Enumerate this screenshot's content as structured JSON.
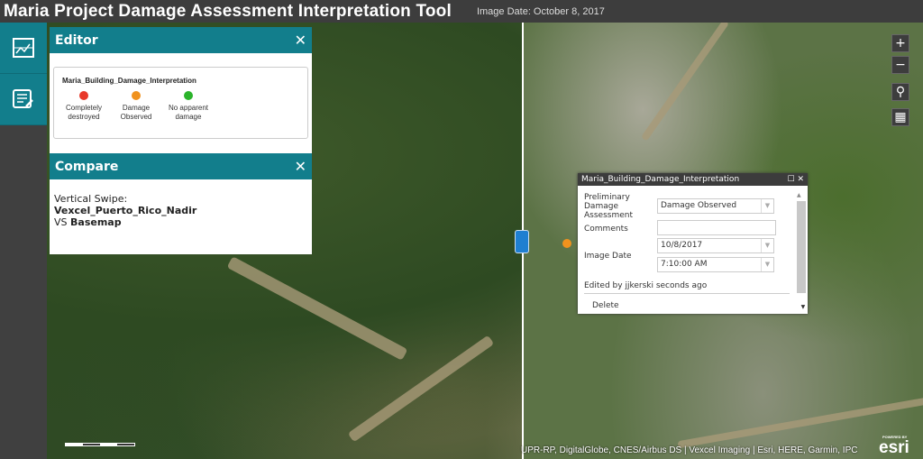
{
  "header": {
    "title": "Maria Project Damage Assessment Interpretation Tool",
    "image_date": "Image Date: October 8, 2017"
  },
  "sidebar": {
    "items": [
      {
        "icon": "swipe-compare-icon"
      },
      {
        "icon": "edit-list-icon"
      }
    ]
  },
  "editor": {
    "title": "Editor",
    "close": "✕",
    "layer": "Maria_Building_Damage_Interpretation",
    "legend": [
      {
        "label": "Completely destroyed",
        "color": "#e8392a"
      },
      {
        "label": "Damage Observed",
        "color": "#f0921e"
      },
      {
        "label": "No apparent damage",
        "color": "#2bb32b"
      }
    ]
  },
  "compare": {
    "title": "Compare",
    "close": "✕",
    "line1": "Vertical Swipe:",
    "layer": "Vexcel_Puerto_Rico_Nadir",
    "vs": "VS ",
    "basemap": "Basemap"
  },
  "popup": {
    "title": "Maria_Building_Damage_Interpretation",
    "maximize": "☐",
    "close": "✕",
    "assessment_label": "Preliminary Damage Assessment",
    "assessment_value": "Damage Observed",
    "comments_label": "Comments",
    "comments_value": "",
    "date_label": "Image Date",
    "date_value": "10/8/2017",
    "time_value": "7:10:00 AM",
    "edited": "Edited by jjkerski seconds ago",
    "delete": "Delete"
  },
  "map_controls": {
    "zoom_in": "+",
    "zoom_out": "−",
    "search": "⚲",
    "basemap": "▦"
  },
  "attribution": "UPR-RP, DigitalGlobe, CNES/Airbus DS | Vexcel Imaging | Esri, HERE, Garmin, IPC",
  "esri": {
    "logo": "esri",
    "powered": "POWERED BY"
  }
}
